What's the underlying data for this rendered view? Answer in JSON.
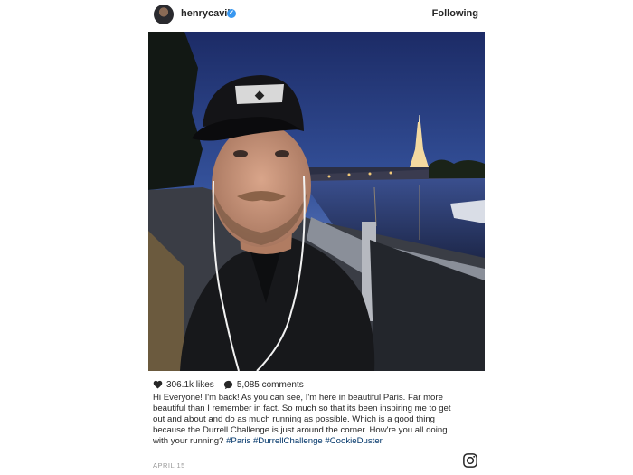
{
  "header": {
    "username": "henrycavill",
    "follow_label": "Following"
  },
  "stats": {
    "likes": "306.1k likes",
    "comments": "5,085 comments"
  },
  "caption": {
    "text": "Hi Everyone! I'm back! As you can see, I'm here in beautiful Paris. Far more beautiful than I remember in fact. So much so that its been inspiring me to get out and about and do as much running as possible. Which is a good thing because the Durrell Challenge is just around the corner. How're you all doing with your running?",
    "hashtags": [
      "#Paris",
      "#DurrellChallenge",
      "#CookieDuster"
    ]
  },
  "date": "APRIL 15",
  "icons": {
    "verified": "verified-badge-icon",
    "like": "heart-icon",
    "comment": "speech-bubble-icon",
    "brand": "instagram-logo-icon"
  },
  "colors": {
    "text": "#262626",
    "hashtag": "#003569",
    "verified": "#3897f0",
    "date": "#999999"
  }
}
